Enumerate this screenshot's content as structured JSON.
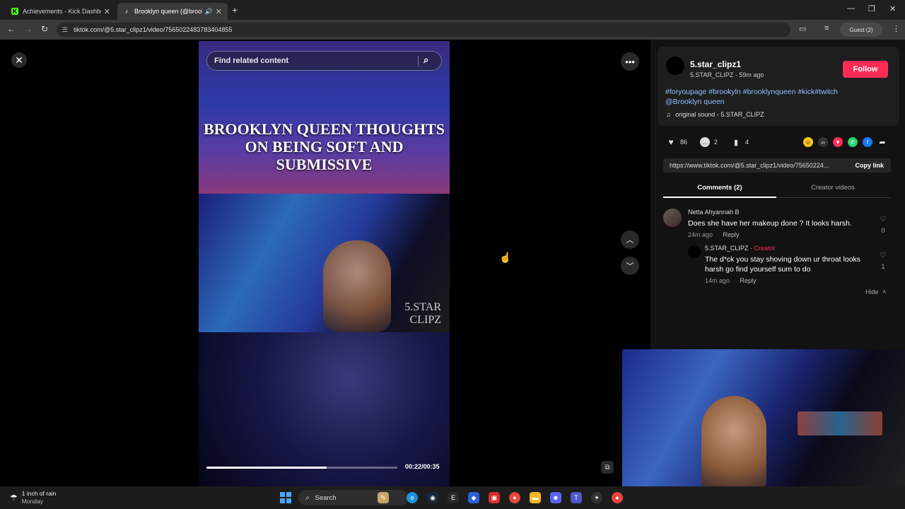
{
  "browser": {
    "tabs": [
      {
        "favicon": "kick-icon",
        "favicon_glyph": "K",
        "title": "Achievements - Kick Dashboard"
      },
      {
        "favicon": "tiktok-icon",
        "favicon_glyph": "♪",
        "title": "Brooklyn queen (@brookly"
      }
    ],
    "url": "tiktok.com/@5.star_clipz1/video/7565022483783404855",
    "profile_label": "Guest (2)"
  },
  "video": {
    "search_placeholder": "Find related content",
    "headline": "BROOKLYN QUEEN THOUGHTS ON BEING SOFT AND SUBMISSIVE",
    "watermark_line1": "5.STAR",
    "watermark_line2": "CLIPZ",
    "time": "00:22/00:35",
    "progress": 0.63
  },
  "post": {
    "username": "5.star_clipz1",
    "meta": "5.STAR_CLIPZ · 59m ago",
    "follow_label": "Follow",
    "caption_line1": "#foryoupage #brookyln #brooklynqueen #kick#twitch",
    "caption_line2": "@Brooklyn queen",
    "sound": "original sound - 5.STAR_CLIPZ",
    "likes": "86",
    "comments": "2",
    "saves": "4",
    "link": "https://www.tiktok.com/@5.star_clipz1/video/75650224...",
    "copy_label": "Copy link",
    "tab_comments": "Comments (2)",
    "tab_creator": "Creator videos"
  },
  "comments": [
    {
      "name": "Netta Ahyannah B",
      "text": "Does she have her makeup done ? It looks harsh.",
      "time": "24m ago",
      "reply_label": "Reply",
      "likes": "0"
    }
  ],
  "reply": {
    "name": "5.STAR_CLIPZ",
    "separator": " · ",
    "creator_label": "Creator",
    "text_line1": "The d*ck you stay shoving down ur throat looks",
    "text_line2": "harsh go find yourself sum to do",
    "time": "14m ago",
    "reply_label": "Reply",
    "likes": "1"
  },
  "hide_label": "Hide",
  "taskbar": {
    "weather_line1": "1 inch of rain",
    "weather_line2": "Monday",
    "search_label": "Search"
  },
  "colors": {
    "follow": "#fe2c55",
    "hashtag": "#8fc1ff",
    "page_bg": "#000000"
  }
}
